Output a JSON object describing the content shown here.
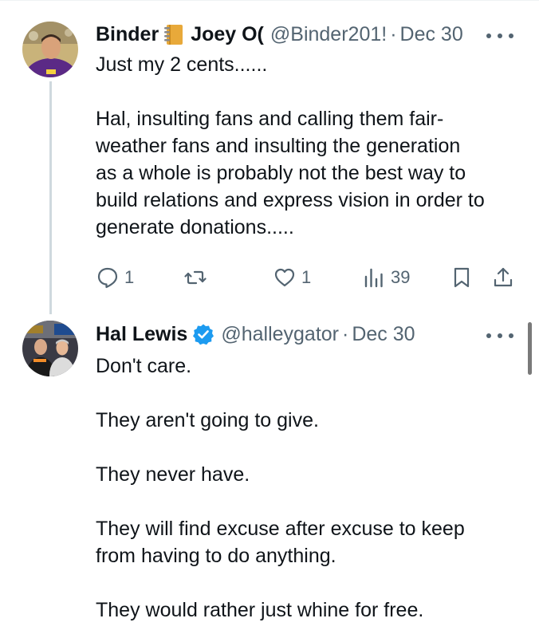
{
  "tweets": [
    {
      "display_name": "Binder",
      "name_emoji": "notebook-icon",
      "name_suffix": "Joey O(",
      "handle": "@Binder201!",
      "separator": "·",
      "time": "Dec 30",
      "lines": [
        "Just my 2 cents......",
        "",
        "Hal, insulting fans and calling them fair-",
        "weather fans and insulting the generation",
        "as a whole is probably not the best way to",
        "build relations and express vision in order to",
        "generate donations....."
      ],
      "actions": {
        "reply_count": "1",
        "retweet_count": "",
        "like_count": "1",
        "views_count": "39"
      }
    },
    {
      "display_name": "Hal Lewis",
      "verified": true,
      "handle": "@halleygator",
      "separator": "·",
      "time": "Dec 30",
      "lines": [
        "Don't care.",
        "",
        "They aren't going to give.",
        "",
        "They never have.",
        "",
        "They will find excuse after excuse to keep",
        "from having to do anything.",
        "",
        "They would rather just whine for free."
      ]
    }
  ],
  "colors": {
    "text_primary": "#0f1419",
    "text_secondary": "#536471",
    "thread_line": "#cfd9de",
    "verified_badge": "#1d9bf0",
    "avatar1_shirt": "#5b2a86",
    "avatar2_bg": "#3a3a44"
  }
}
